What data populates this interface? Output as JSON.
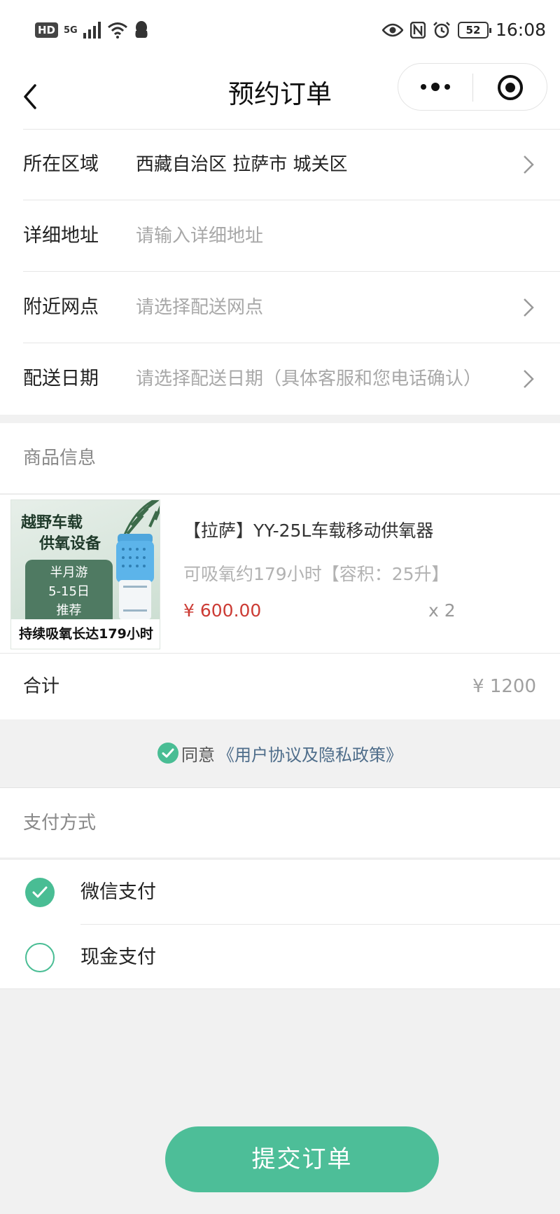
{
  "status_bar": {
    "hd": "HD",
    "network": "5G",
    "battery": "52",
    "time": "16:08"
  },
  "nav": {
    "title": "预约订单"
  },
  "form": {
    "rows": [
      {
        "label": "所在区域",
        "value": "西藏自治区 拉萨市 城关区",
        "placeholder": ""
      },
      {
        "label": "详细地址",
        "value": "",
        "placeholder": "请输入详细地址"
      },
      {
        "label": "附近网点",
        "value": "",
        "placeholder": "请选择配送网点"
      },
      {
        "label": "配送日期",
        "value": "",
        "placeholder": "请选择配送日期（具体客服和您电话确认）"
      }
    ]
  },
  "goods": {
    "section_title": "商品信息",
    "thumb": {
      "line1": "越野车载",
      "line2": "供氧设备",
      "badge_1": "半月游",
      "badge_2": "5-15日",
      "badge_3": "推荐",
      "footer": "持续吸氧长达179小时"
    },
    "name": "【拉萨】YY-25L车载移动供氧器",
    "desc": "可吸氧约179小时【容积：25升】",
    "price": "¥ 600.00",
    "qty": "x 2"
  },
  "total": {
    "label": "合计",
    "value": "¥ 1200"
  },
  "agreement": {
    "prefix": "同意",
    "link": "《用户协议及隐私政策》",
    "checked": true
  },
  "payment": {
    "section_title": "支付方式",
    "options": [
      {
        "label": "微信支付",
        "selected": true
      },
      {
        "label": "现金支付",
        "selected": false
      }
    ]
  },
  "submit_label": "提交订单",
  "colors": {
    "accent": "#49bd94",
    "price": "#cc3b34",
    "link": "#4e6d8a"
  }
}
